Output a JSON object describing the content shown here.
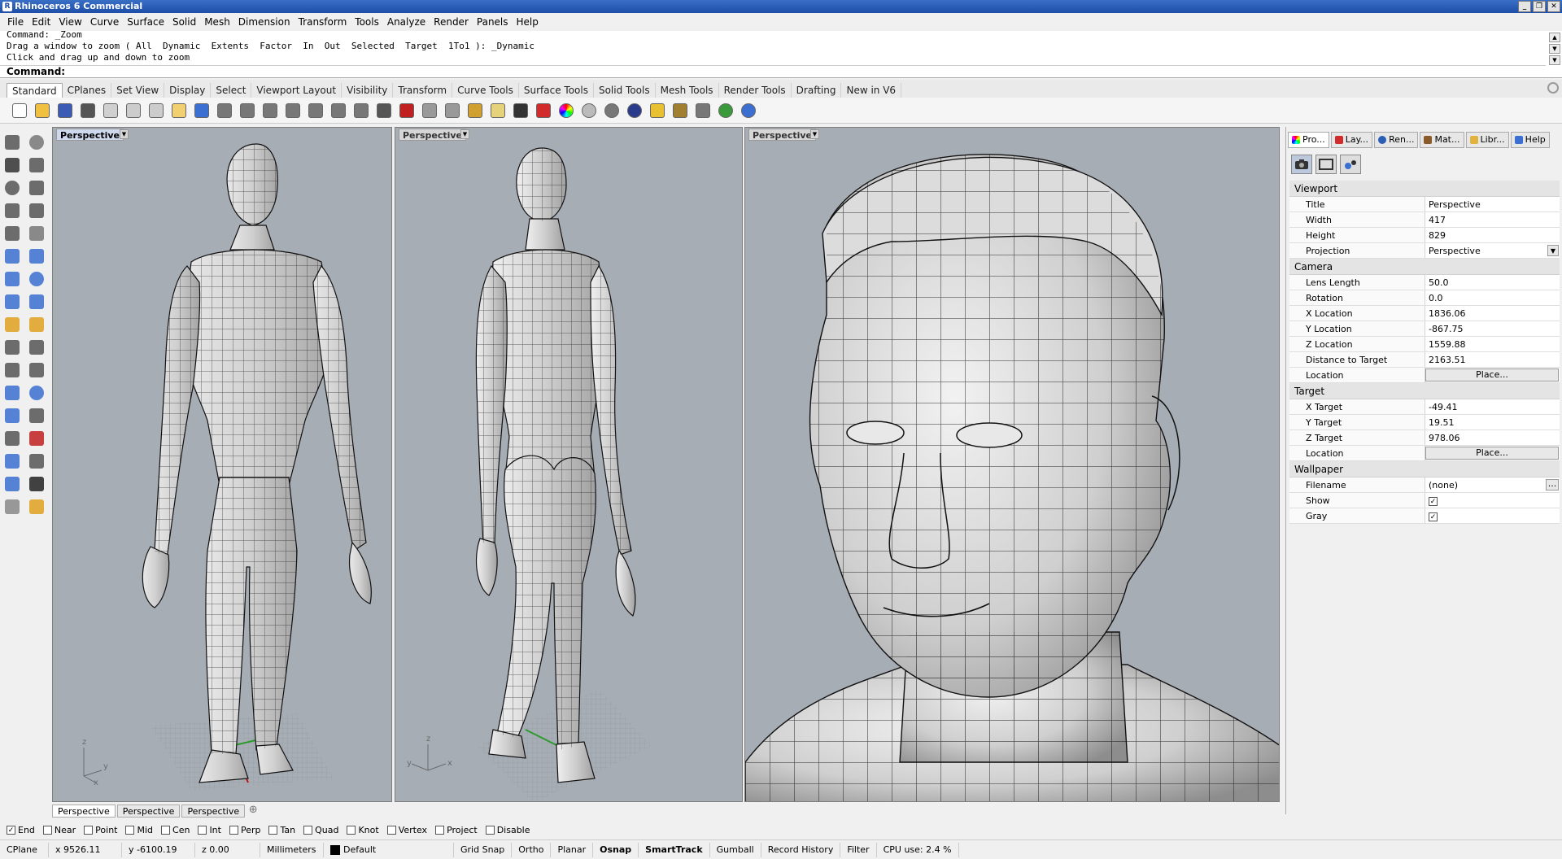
{
  "window": {
    "title": "Rhinoceros 6 Commercial"
  },
  "menu": [
    "File",
    "Edit",
    "View",
    "Curve",
    "Surface",
    "Solid",
    "Mesh",
    "Dimension",
    "Transform",
    "Tools",
    "Analyze",
    "Render",
    "Panels",
    "Help"
  ],
  "command": {
    "history": [
      "Command: _Zoom",
      "Drag a window to zoom ( All  Dynamic  Extents  Factor  In  Out  Selected  Target  1To1 ): _Dynamic",
      "Click and drag up and down to zoom"
    ],
    "prompt": "Command:"
  },
  "toolbar_tabs": [
    "Standard",
    "CPlanes",
    "Set View",
    "Display",
    "Select",
    "Viewport Layout",
    "Visibility",
    "Transform",
    "Curve Tools",
    "Surface Tools",
    "Solid Tools",
    "Mesh Tools",
    "Render Tools",
    "Drafting",
    "New in V6"
  ],
  "toolbar_icons": [
    "new-icon",
    "open-icon",
    "save-icon",
    "print-icon",
    "import-icon",
    "cut-icon",
    "copy-icon",
    "paste-icon",
    "undo-icon",
    "pan-icon",
    "rotate-view-icon",
    "zoom-dynamic-icon",
    "zoom-window-icon",
    "zoom-extents-icon",
    "zoom-selected-icon",
    "undo-view-icon",
    "four-viewports-icon",
    "car-icon",
    "cplane-icon",
    "cplane-origin-icon",
    "point-object-icon",
    "light-icon",
    "lock-icon",
    "layer-icon",
    "color-wheel-icon",
    "wireframe-sphere-icon",
    "shaded-sphere-icon",
    "rendered-sphere-icon",
    "render-icon",
    "options-gear-icon",
    "dimension-icon",
    "globe-icon",
    "help-icon"
  ],
  "side_tools": [
    "select-arrow-icon",
    "point-icon",
    "polyline-icon",
    "curve-icon",
    "circle-icon",
    "arc-icon",
    "ellipse-icon",
    "rectangle-icon",
    "polygon-icon",
    "freeform-icon",
    "surface-icon",
    "extrude-icon",
    "box-icon",
    "sphere-icon",
    "cylinder-icon",
    "plane-icon",
    "explode-icon",
    "boolean-icon",
    "split-icon",
    "trim-icon",
    "fillet-icon",
    "offset-icon",
    "rebuild-icon",
    "points-on-icon",
    "move-icon",
    "rotate-icon",
    "array-icon",
    "scale-icon",
    "mirror-icon",
    "group-icon",
    "analyze-icon",
    "check-icon",
    "mesh-icon",
    "render-mat-icon"
  ],
  "viewports": [
    {
      "title": "Perspective",
      "active": true
    },
    {
      "title": "Perspective",
      "active": false
    },
    {
      "title": "Perspective",
      "active": false
    }
  ],
  "axis_labels": {
    "x": "x",
    "y": "y",
    "z": "z"
  },
  "viewport_tabs": [
    "Perspective",
    "Perspective",
    "Perspective"
  ],
  "panel_tabs": [
    "Pro...",
    "Lay...",
    "Ren...",
    "Mat...",
    "Libr...",
    "Help"
  ],
  "properties": {
    "viewport": {
      "section": "Viewport",
      "rows": [
        {
          "k": "Title",
          "v": "Perspective"
        },
        {
          "k": "Width",
          "v": "417"
        },
        {
          "k": "Height",
          "v": "829"
        },
        {
          "k": "Projection",
          "v": "Perspective"
        }
      ]
    },
    "camera": {
      "section": "Camera",
      "rows": [
        {
          "k": "Lens Length",
          "v": "50.0"
        },
        {
          "k": "Rotation",
          "v": "0.0"
        },
        {
          "k": "X Location",
          "v": "1836.06"
        },
        {
          "k": "Y Location",
          "v": "-867.75"
        },
        {
          "k": "Z Location",
          "v": "1559.88"
        },
        {
          "k": "Distance to Target",
          "v": "2163.51"
        },
        {
          "k": "Location",
          "v": "Place..."
        }
      ]
    },
    "target": {
      "section": "Target",
      "rows": [
        {
          "k": "X Target",
          "v": "-49.41"
        },
        {
          "k": "Y Target",
          "v": "19.51"
        },
        {
          "k": "Z Target",
          "v": "978.06"
        },
        {
          "k": "Location",
          "v": "Place..."
        }
      ]
    },
    "wallpaper": {
      "section": "Wallpaper",
      "rows": [
        {
          "k": "Filename",
          "v": "(none)"
        },
        {
          "k": "Show",
          "v": "✓"
        },
        {
          "k": "Gray",
          "v": "✓"
        }
      ]
    }
  },
  "osnaps": [
    {
      "label": "End",
      "checked": true
    },
    {
      "label": "Near",
      "checked": false
    },
    {
      "label": "Point",
      "checked": false
    },
    {
      "label": "Mid",
      "checked": false
    },
    {
      "label": "Cen",
      "checked": false
    },
    {
      "label": "Int",
      "checked": false
    },
    {
      "label": "Perp",
      "checked": false
    },
    {
      "label": "Tan",
      "checked": false
    },
    {
      "label": "Quad",
      "checked": false
    },
    {
      "label": "Knot",
      "checked": false
    },
    {
      "label": "Vertex",
      "checked": false
    },
    {
      "label": "Project",
      "checked": false
    },
    {
      "label": "Disable",
      "checked": false
    }
  ],
  "status": {
    "cplane": "CPlane",
    "x": "x 9526.11",
    "y": "y -6100.19",
    "z": "z 0.00",
    "units": "Millimeters",
    "layer": "Default",
    "grid_snap": "Grid Snap",
    "ortho": "Ortho",
    "planar": "Planar",
    "osnap": "Osnap",
    "smarttrack": "SmartTrack",
    "gumball": "Gumball",
    "record_history": "Record History",
    "filter": "Filter",
    "cpu": "CPU use: 2.4 %"
  },
  "colors": {
    "accent": "#1e4ea8",
    "viewport_bg": "#a7adb5",
    "active_tab": "#cfd9ee"
  }
}
